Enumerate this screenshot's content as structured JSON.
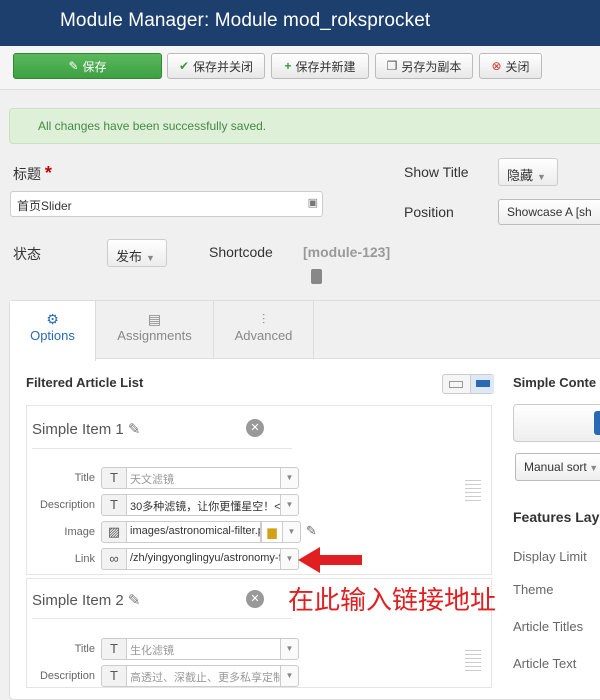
{
  "header": {
    "title": "Module Manager: Module mod_roksprocket"
  },
  "toolbar": {
    "save": "保存",
    "save_close": "保存并关闭",
    "save_new": "保存并新建",
    "save_copy": "另存为副本",
    "close": "关闭"
  },
  "alert": {
    "message": "All changes have been successfully saved."
  },
  "form": {
    "title_label": "标题",
    "required_mark": "*",
    "title_value": "首页Slider",
    "show_title_label": "Show Title",
    "show_title_value": "隐藏",
    "position_label": "Position",
    "position_value": "Showcase A [sh",
    "status_label": "状态",
    "status_value": "发布",
    "shortcode_label": "Shortcode",
    "shortcode_value": "[module-123]"
  },
  "tabs": [
    {
      "label": "Options"
    },
    {
      "label": "Assignments"
    },
    {
      "label": "Advanced"
    }
  ],
  "filtered_list": {
    "title": "Filtered Article List",
    "items": [
      {
        "name": "Simple Item 1",
        "fields": {
          "title_label": "Title",
          "title_value": "天文滤镜",
          "desc_label": "Description",
          "desc_value": "30多种滤镜，让你更懂星空！<",
          "image_label": "Image",
          "image_value": "images/astronomical-filter.p",
          "link_label": "Link",
          "link_value": "/zh/yingyonglingyu/astronomy-f"
        }
      },
      {
        "name": "Simple Item 2",
        "fields": {
          "title_label": "Title",
          "title_value": "生化滤镜",
          "desc_label": "Description",
          "desc_value": "高透过、深截止、更多私享定制"
        }
      }
    ]
  },
  "sidebar": {
    "simple_content_title": "Simple Conte",
    "sort_value": "Manual sort",
    "features_title": "Features Lay",
    "display_limit": "Display Limit",
    "theme": "Theme",
    "article_titles": "Article Titles",
    "article_text": "Article Text"
  },
  "annotation": {
    "text": "在此输入链接地址",
    "color": "#e02020"
  },
  "colors": {
    "header_bg": "#1d3f6e",
    "save_green": "#46a546",
    "active_tab": "#2a6ab5"
  }
}
